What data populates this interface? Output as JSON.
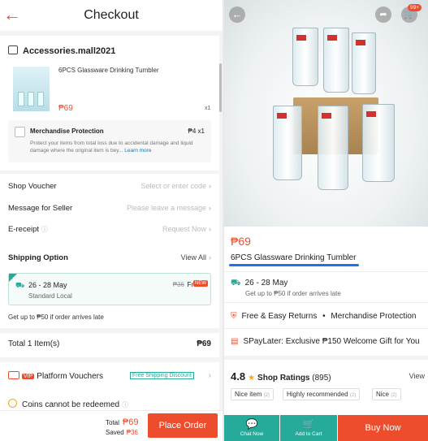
{
  "left": {
    "header": {
      "title": "Checkout"
    },
    "shop": {
      "name": "Accessories.mall2021"
    },
    "product": {
      "name": "6PCS Glassware Drinking Tumbler",
      "price": "₱69",
      "qty": "x1"
    },
    "merch": {
      "title": "Merchandise Protection",
      "price": "₱4 x1",
      "desc": "Protect your items from total loss due to accidental damage and liquid damage where the original item is bey...",
      "learn": "Learn more"
    },
    "rows": {
      "voucher_label": "Shop Voucher",
      "voucher_value": "Select or enter code",
      "message_label": "Message for Seller",
      "message_value": "Please leave a message",
      "ereceipt_label": "E-receipt",
      "ereceipt_value": "Request Now",
      "shipping_label": "Shipping Option",
      "shipping_value": "View All"
    },
    "shipping": {
      "dates": "26 - 28 May",
      "service": "Standard Local",
      "old_price": "₱36",
      "free": "Free",
      "tag": "NEW"
    },
    "note": "Get up to ₱50 if order arrives late",
    "total_items": {
      "label": "Total 1 Item(s)",
      "value": "₱69"
    },
    "platform": {
      "badge": "VIP",
      "label": "Platform Vouchers",
      "tag": "Free Shipping Discount"
    },
    "coins": {
      "label": "Coins cannot be redeemed"
    },
    "footer": {
      "total_label": "Total",
      "total_value": "₱69",
      "saved_label": "Saved",
      "saved_value": "₱36",
      "place_order": "Place Order"
    }
  },
  "right": {
    "badge": "99+",
    "price": "₱69",
    "name": "6PCS Glassware Drinking Tumbler",
    "ship_dates": "26 - 28 May",
    "ship_note": "Get up to ₱50 if order arrives late",
    "returns": "Free & Easy Returns",
    "bullet": "•",
    "merch": "Merchandise Protection",
    "spay": "SPayLater: Exclusive ₱150 Welcome Gift for You",
    "rating": {
      "score": "4.8",
      "label": "Shop Ratings",
      "count": "(895)",
      "view": "View"
    },
    "chips": [
      {
        "label": "Nice item",
        "count": "(2)"
      },
      {
        "label": "Highly recommended",
        "count": "(2)"
      },
      {
        "label": "Nice",
        "count": "(2)"
      }
    ],
    "footer": {
      "chat": "Chat Now",
      "cart": "Add to Cart",
      "buy": "Buy Now"
    }
  }
}
